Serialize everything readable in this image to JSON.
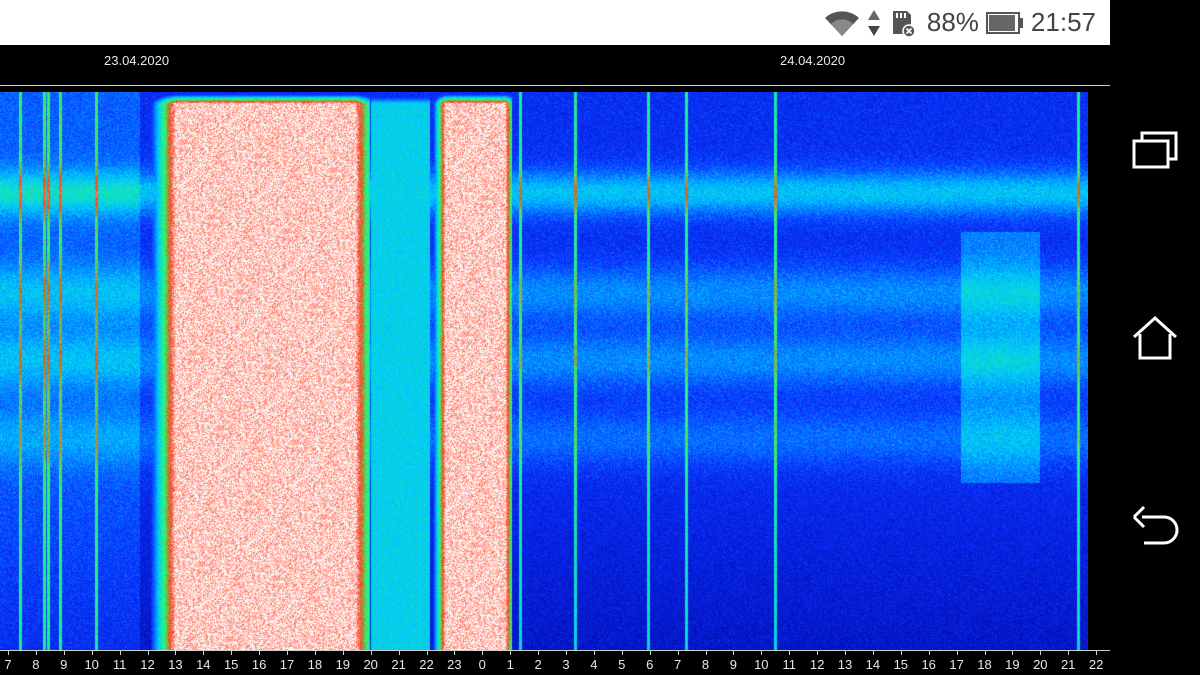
{
  "status_bar": {
    "battery_percent": "88%",
    "time": "21:57",
    "icons": [
      "wifi-icon",
      "data-transfer-icon",
      "sd-card-icon",
      "battery-icon"
    ]
  },
  "chart": {
    "dates": [
      "23.04.2020",
      "24.04.2020"
    ],
    "hour_labels": [
      "7",
      "8",
      "9",
      "10",
      "11",
      "12",
      "13",
      "14",
      "15",
      "16",
      "17",
      "18",
      "19",
      "20",
      "21",
      "22",
      "23",
      "0",
      "1",
      "2",
      "3",
      "4",
      "5",
      "6",
      "7",
      "8",
      "9",
      "10",
      "11",
      "12",
      "13",
      "14",
      "15",
      "16",
      "17",
      "18",
      "19",
      "20",
      "21",
      "22"
    ]
  },
  "chart_data": {
    "type": "heatmap",
    "x_axis_dates": [
      "23.04.2020",
      "24.04.2020"
    ],
    "x_tick_labels": [
      "7",
      "8",
      "9",
      "10",
      "11",
      "12",
      "13",
      "14",
      "15",
      "16",
      "17",
      "18",
      "19",
      "20",
      "21",
      "22",
      "23",
      "0",
      "1",
      "2",
      "3",
      "4",
      "5",
      "6",
      "7",
      "8",
      "9",
      "10",
      "11",
      "12",
      "13",
      "14",
      "15",
      "16",
      "17",
      "18",
      "19",
      "20",
      "21",
      "22"
    ],
    "colormap": [
      "#0000a0",
      "#0a3cff",
      "#00c8ff",
      "#30ff60",
      "#ff3020",
      "#ffffff"
    ]
  },
  "navbar": {
    "icons": [
      "recent-apps-icon",
      "home-icon",
      "back-icon"
    ]
  },
  "colors": {
    "status_bar_bg": "#ffffff",
    "status_text": "#444444",
    "background": "#000000"
  }
}
